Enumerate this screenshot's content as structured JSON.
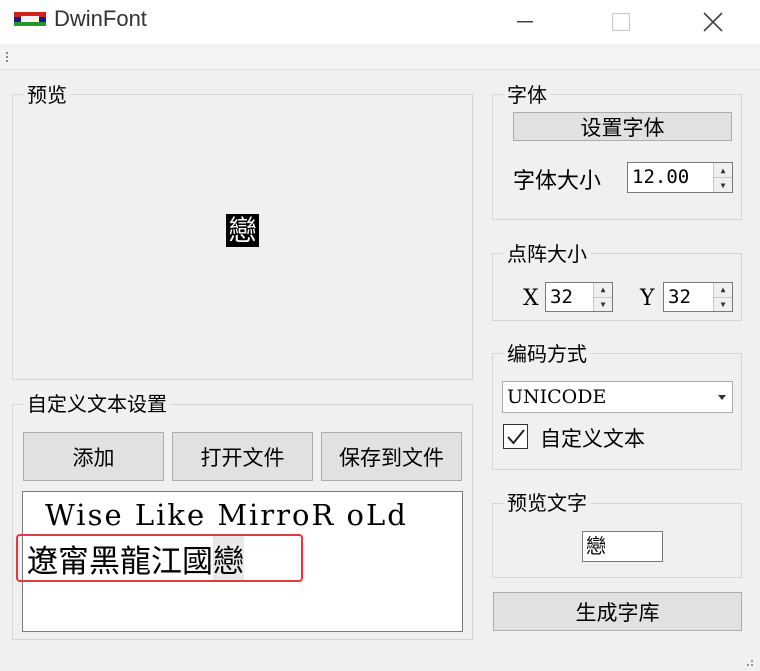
{
  "window": {
    "title": "DwinFont",
    "minimize_glyph": "—",
    "maximize_glyph": "☐",
    "close_glyph": "✕"
  },
  "preview": {
    "group_label": "预览",
    "glyph": "戀"
  },
  "custom_text": {
    "group_label": "自定义文本设置",
    "add_label": "添加",
    "open_file_label": "打开文件",
    "save_to_file_label": "保存到文件",
    "line1": "Wise Like MirroR oLd",
    "line2_plain": "遼甯黑龍江國",
    "line2_highlighted": "戀"
  },
  "font": {
    "group_label": "字体",
    "set_font_label": "设置字体",
    "size_label": "字体大小",
    "size_value": "12.00"
  },
  "matrix": {
    "group_label": "点阵大小",
    "x_label": "X",
    "x_value": "32",
    "y_label": "Y",
    "y_value": "32"
  },
  "encoding": {
    "group_label": "编码方式",
    "selected": "UNICODE",
    "custom_text_checkbox_label": "自定义文本",
    "custom_text_checked": "✓"
  },
  "preview_text": {
    "group_label": "预览文字",
    "value": "戀"
  },
  "generate_label": "生成字库",
  "colors": {
    "highlight_red": "#e23a3a",
    "window_bg": "#f0f0f0",
    "button_bg": "#e1e1e1"
  }
}
